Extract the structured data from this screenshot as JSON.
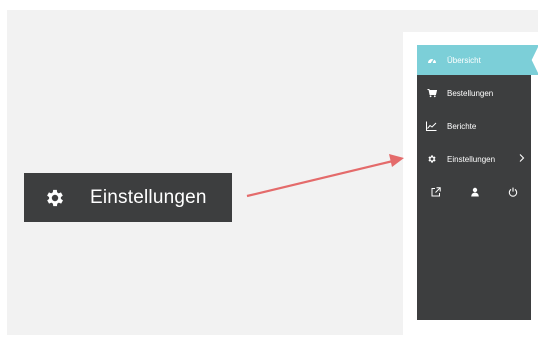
{
  "callout": {
    "label": "Einstellungen",
    "icon": "gear-icon"
  },
  "sidebar": {
    "items": [
      {
        "label": "Übersicht",
        "icon": "dashboard-icon",
        "active": true
      },
      {
        "label": "Bestellungen",
        "icon": "cart-icon",
        "active": false
      },
      {
        "label": "Berichte",
        "icon": "line-chart-icon",
        "active": false
      },
      {
        "label": "Einstellungen",
        "icon": "gear-icon",
        "active": false,
        "has_submenu": true
      }
    ],
    "footer_icons": [
      "external-link-icon",
      "user-icon",
      "power-icon"
    ]
  },
  "colors": {
    "sidebar_bg": "#3d3e3f",
    "active_item_bg": "#7ccfd8",
    "arrow": "#e46b6b",
    "canvas_bg": "#f2f2f2"
  }
}
